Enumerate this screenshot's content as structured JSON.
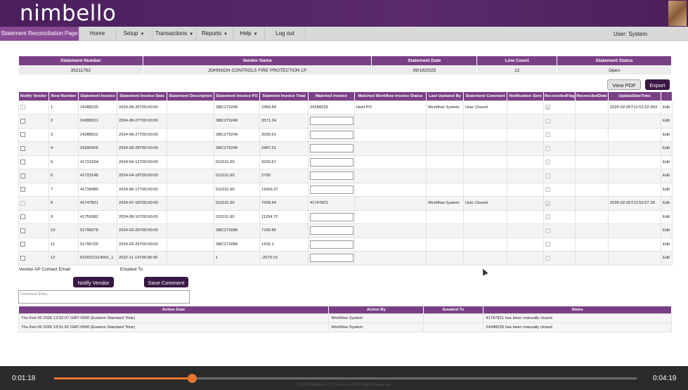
{
  "header": {
    "logo_text": "nimbello"
  },
  "menu": {
    "items": [
      {
        "label": "Statement Reconciliation Page"
      },
      {
        "label": "Home"
      },
      {
        "label": "Setup"
      },
      {
        "label": "Transactions"
      },
      {
        "label": "Reports"
      },
      {
        "label": "Help"
      },
      {
        "label": "Log out"
      }
    ],
    "user": "User: System"
  },
  "summary": {
    "headers": [
      "Statement Number",
      "Vendor Name",
      "Statement Date",
      "Line Count",
      "Statement Status"
    ],
    "values": [
      "35211762",
      "JOHNSON CONTROLS FIRE PROTECTION LP",
      "09/18/2025",
      "12",
      "Open"
    ]
  },
  "actions": {
    "view_pdf": "View PDF",
    "export": "Export"
  },
  "grid": {
    "headers": [
      "Notify Vendor",
      "Row Number",
      "Statement Invoice",
      "Statement Invoice Date",
      "Statement Description",
      "Statement Invoice PO",
      "Statment Invoice Total",
      "Matched Invoice",
      "Matched Workflow Invoice Status",
      "Last Updated By",
      "Statement Comment",
      "Notification Sent",
      "ReconciledFlag",
      "ReconciledDate",
      "UpdateDateTime",
      ""
    ],
    "edit_label": "Edit",
    "rows": [
      {
        "row": "1",
        "invoice": "24288235",
        "date": "2024-08-26T00:00:00",
        "desc": "",
        "po": "SBC279249",
        "total": "2469.84",
        "matched": "24288235",
        "status": "Hold PO",
        "updated_by": "Workflow System",
        "comment": "User Closed",
        "sent": "",
        "reconciled": true,
        "rdate": "",
        "udt": "2026-02-05T13:51:52.903",
        "locked": true
      },
      {
        "row": "2",
        "invoice": "24288921",
        "date": "2024-08-27T00:00:00",
        "desc": "",
        "po": "SBC279249",
        "total": "3371.24",
        "matched": "",
        "status": "",
        "updated_by": "",
        "comment": "",
        "sent": "",
        "reconciled": false,
        "rdate": "",
        "udt": "",
        "locked": false
      },
      {
        "row": "3",
        "invoice": "24288922",
        "date": "2024-08-27T00:00:00",
        "desc": "",
        "po": "SBC279249",
        "total": "2005.61",
        "matched": "",
        "status": "",
        "updated_by": "",
        "comment": "",
        "sent": "",
        "reconciled": false,
        "rdate": "",
        "udt": "",
        "locked": false
      },
      {
        "row": "4",
        "invoice": "24290426",
        "date": "2024-08-28T00:00:00",
        "desc": "",
        "po": "SBC279249",
        "total": "2487.51",
        "matched": "",
        "status": "",
        "updated_by": "",
        "comment": "",
        "sent": "",
        "reconciled": false,
        "rdate": "",
        "udt": "",
        "locked": false
      },
      {
        "row": "5",
        "invoice": "41721554",
        "date": "2024-04-12T00:00:00",
        "desc": "",
        "po": "011011.60",
        "total": "9320.67",
        "matched": "",
        "status": "",
        "updated_by": "",
        "comment": "",
        "sent": "",
        "reconciled": false,
        "rdate": "",
        "udt": "",
        "locked": false
      },
      {
        "row": "6",
        "invoice": "41723148",
        "date": "2024-04-18T00:00:00",
        "desc": "",
        "po": "011011.60",
        "total": "2700",
        "matched": "",
        "status": "",
        "updated_by": "",
        "comment": "",
        "sent": "",
        "reconciled": false,
        "rdate": "",
        "udt": "",
        "locked": false
      },
      {
        "row": "7",
        "invoice": "41739480",
        "date": "2024-06-17T00:00:00",
        "desc": "",
        "po": "011011.60",
        "total": "11666.37",
        "matched": "",
        "status": "",
        "updated_by": "",
        "comment": "",
        "sent": "",
        "reconciled": false,
        "rdate": "",
        "udt": "",
        "locked": false
      },
      {
        "row": "8",
        "invoice": "41747821",
        "date": "2024-07-18T00:00:00",
        "desc": "",
        "po": "011011.60",
        "total": "7428.94",
        "matched": "41747821",
        "status": "",
        "updated_by": "Workflow System",
        "comment": "User Closed",
        "sent": "",
        "reconciled": true,
        "rdate": "",
        "udt": "2026-02-05T13:52:07.36",
        "locked": true
      },
      {
        "row": "9",
        "invoice": "41755382",
        "date": "2024-08-16T00:00:00",
        "desc": "",
        "po": "011011.60",
        "total": "11154.72",
        "matched": "",
        "status": "",
        "updated_by": "",
        "comment": "",
        "sent": "",
        "reconciled": false,
        "rdate": "",
        "udt": "",
        "locked": false
      },
      {
        "row": "10",
        "invoice": "51796678",
        "date": "2024-03-29T00:00:00",
        "desc": "",
        "po": "SBC273095",
        "total": "7190.85",
        "matched": "",
        "status": "",
        "updated_by": "",
        "comment": "",
        "sent": "",
        "reconciled": false,
        "rdate": "",
        "udt": "",
        "locked": false
      },
      {
        "row": "11",
        "invoice": "51796700",
        "date": "2024-03-29T00:00:00",
        "desc": "",
        "po": "SBC273089",
        "total": "1916.1",
        "matched": "",
        "status": "",
        "updated_by": "",
        "comment": "",
        "sent": "",
        "reconciled": false,
        "rdate": "",
        "udt": "",
        "locked": false
      },
      {
        "row": "12",
        "invoice": "6320221114001_1",
        "date": "2022-11-14T00:00:00",
        "desc": "",
        "po": "1",
        "total": "-2070.15",
        "matched": "",
        "status": "",
        "updated_by": "",
        "comment": "",
        "sent": "",
        "reconciled": false,
        "rdate": "",
        "udt": "",
        "locked": false
      }
    ]
  },
  "form": {
    "contact_email_label": "Vendor AP Contact Email",
    "emailed_to_label": "Emailed To",
    "notify_button": "Notify Vendor",
    "save_comment_button": "Save Comment",
    "comment_placeholder": "Comment Entry"
  },
  "history": {
    "headers": [
      "Action Date",
      "Action By",
      "Emailed To",
      "Notes"
    ],
    "rows": [
      {
        "date": "Thu Feb 05 2026 13:52:07 GMT-0500 (Eastern Standard Time)",
        "by": "Workflow System",
        "to": "",
        "notes": "41747821 has been manually closed"
      },
      {
        "date": "Thu Feb 05 2026 13:51:52 GMT-0500 (Eastern Standard Time)",
        "by": "Workflow System",
        "to": "",
        "notes": "24288235 has been manually closed"
      }
    ]
  },
  "video": {
    "current": "0:01:18",
    "total": "0:04:19",
    "progress": 0.237
  },
  "footer": {
    "copyright": "©2026 Nimbello LLC Version 4.00 All Rights Reserved"
  },
  "colors": {
    "brand": "#4a1f5c",
    "header_cell": "#7a3f87",
    "accent": "#e8772e"
  }
}
